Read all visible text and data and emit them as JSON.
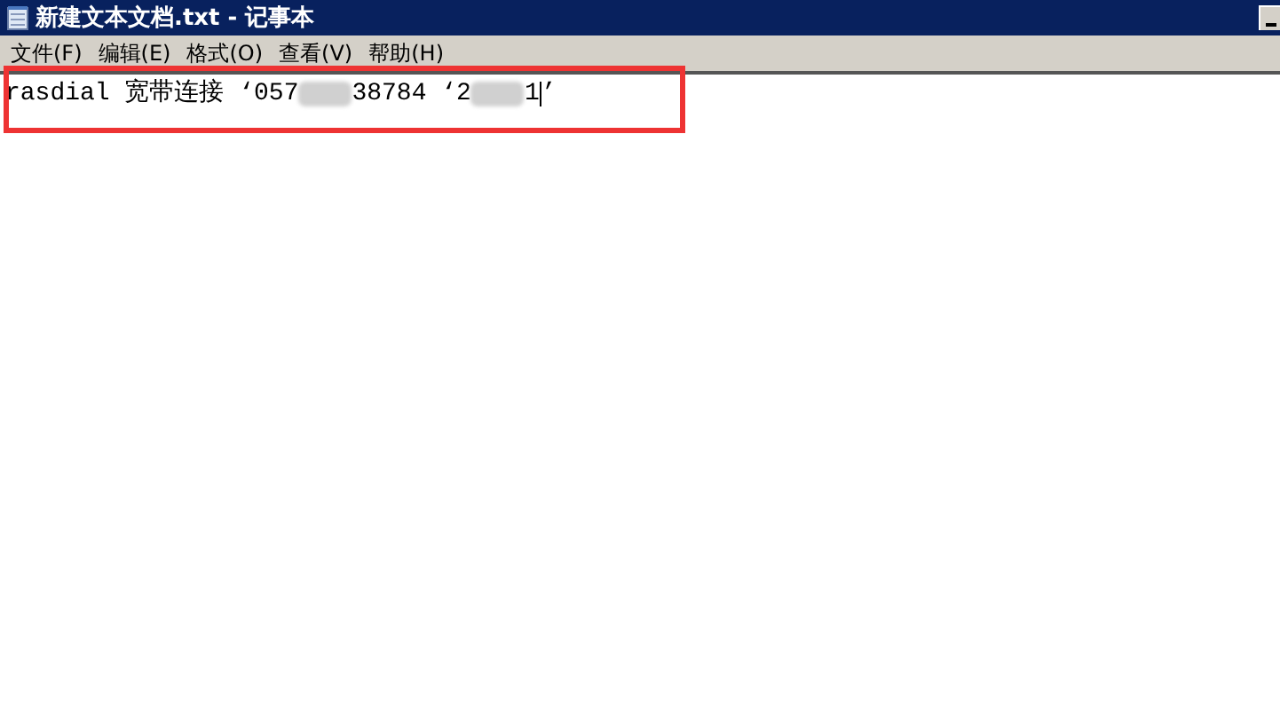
{
  "window": {
    "title": "新建文本文档.txt - 记事本"
  },
  "menu": [
    "文件(F)",
    "编辑(E)",
    "格式(O)",
    "查看(V)",
    "帮助(H)"
  ],
  "editor": {
    "segments": [
      {
        "kind": "text",
        "text": "rasdial 宽带连接 ‘057"
      },
      {
        "kind": "redaction"
      },
      {
        "kind": "text",
        "text": "38784 ‘2"
      },
      {
        "kind": "redaction"
      },
      {
        "kind": "text",
        "text": "1"
      },
      {
        "kind": "caret"
      },
      {
        "kind": "text",
        "text": "’"
      }
    ],
    "highlighted": true
  }
}
